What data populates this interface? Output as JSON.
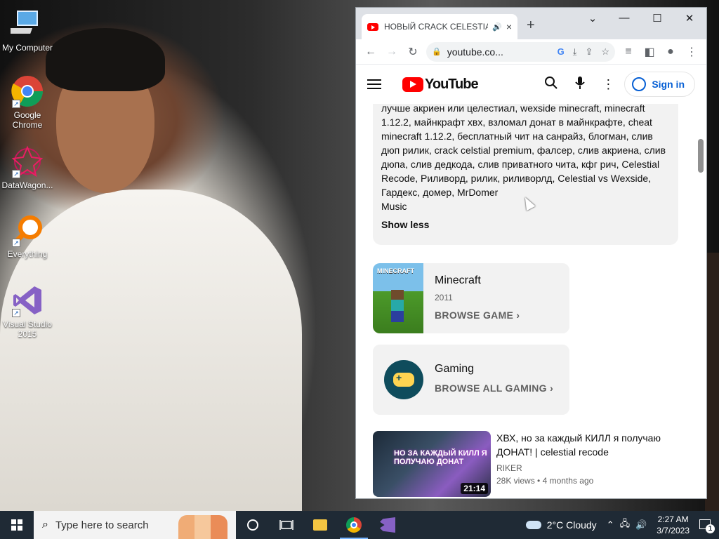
{
  "desktop": {
    "icons": [
      {
        "label": "My Computer"
      },
      {
        "label": "Google Chrome"
      },
      {
        "label": "DataWagon..."
      },
      {
        "label": "Everything"
      },
      {
        "label": "Visual Studio 2015"
      }
    ]
  },
  "browser": {
    "tab": {
      "title": "НОВЫЙ CRACK CELESTIAL",
      "audio_icon": "speaker-icon",
      "close": "×"
    },
    "new_tab": "+",
    "window_controls": {
      "menu": "⌄",
      "minimize": "—",
      "maximize": "☐",
      "close": "✕"
    },
    "toolbar": {
      "url": "youtube.co..."
    }
  },
  "youtube": {
    "logo_text": "YouTube",
    "sign_in": "Sign in",
    "description": {
      "text": "лучше акриен или целестиал, wexside minecraft, minecraft 1.12.2, майнкрафт хвх, взломал донат в майнкрафте, cheat minecraft 1.12.2, бесплатный чит на санрайз, блогман, слив дюп рилик, crack celstial premium, фалсер, слив акриена, слив дюпа, слив дедкода, слив приватного чита, кфг рич, Celestial Recode, Риливорд, рилик, риливорлд, Celestial vs Wexside, Гардекс, домер, MrDomer",
      "category": "Music",
      "show_less": "Show less"
    },
    "game_card": {
      "thumb_label": "MINECRAFT",
      "title": "Minecraft",
      "year": "2011",
      "link": "BROWSE GAME"
    },
    "gaming_card": {
      "title": "Gaming",
      "link": "BROWSE ALL GAMING"
    },
    "video": {
      "thumb_text": "НО ЗА КАЖДЫЙ КИЛЛ Я ПОЛУЧАЮ ДОНАТ",
      "duration": "21:14",
      "title": "ХВХ, но за каждый КИЛЛ я получаю ДОНАТ! | celestial recode",
      "channel": "RIKER",
      "views": "28K views",
      "age": "4 months ago"
    }
  },
  "taskbar": {
    "search_placeholder": "Type here to search",
    "weather": "2°C  Cloudy",
    "time": "2:27 AM",
    "date": "3/7/2023",
    "notification_count": "1"
  }
}
